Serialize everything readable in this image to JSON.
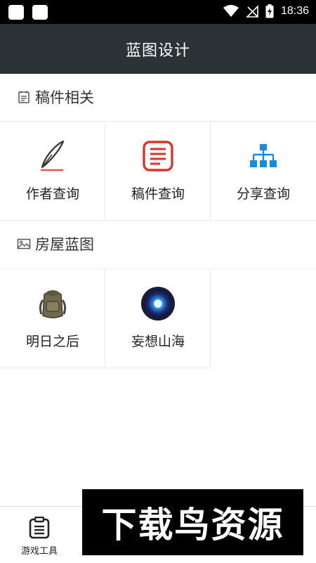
{
  "status_bar": {
    "time": "18:36"
  },
  "header": {
    "title": "蓝图设计"
  },
  "sections": [
    {
      "title": "稿件相关",
      "items": [
        {
          "label": "作者查询",
          "icon": "pen-icon"
        },
        {
          "label": "稿件查询",
          "icon": "document-icon"
        },
        {
          "label": "分享查询",
          "icon": "sitemap-icon"
        }
      ]
    },
    {
      "title": "房屋蓝图",
      "items": [
        {
          "label": "明日之后",
          "icon": "backpack-icon"
        },
        {
          "label": "妄想山海",
          "icon": "blue-orb-icon"
        }
      ]
    }
  ],
  "bottom_nav": {
    "tab_label": "游戏工具"
  },
  "watermark": {
    "text": "下载鸟资源"
  },
  "colors": {
    "title_bar": "#2a3336",
    "accent_red": "#d9362b",
    "accent_blue": "#1e88d9"
  }
}
